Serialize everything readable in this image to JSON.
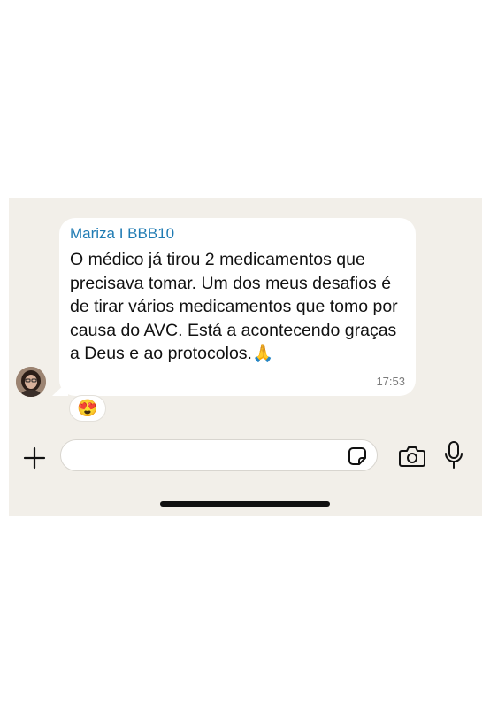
{
  "message": {
    "sender": "Mariza I BBB10",
    "text": "O médico já tirou 2 medicamentos que precisava tomar. Um dos meus desafios é de tirar vários medicamentos que tomo por causa do AVC. Está a acontecendo graças a Deus e ao protocolos.🙏",
    "time": "17:53",
    "reaction": "😍"
  },
  "composer": {
    "input_value": ""
  },
  "icons": {
    "plus": "plus-icon",
    "sticker": "sticker-icon",
    "camera": "camera-icon",
    "mic": "microphone-icon"
  },
  "colors": {
    "sender": "#1f7bb3",
    "chat_background": "#f2efe9"
  }
}
